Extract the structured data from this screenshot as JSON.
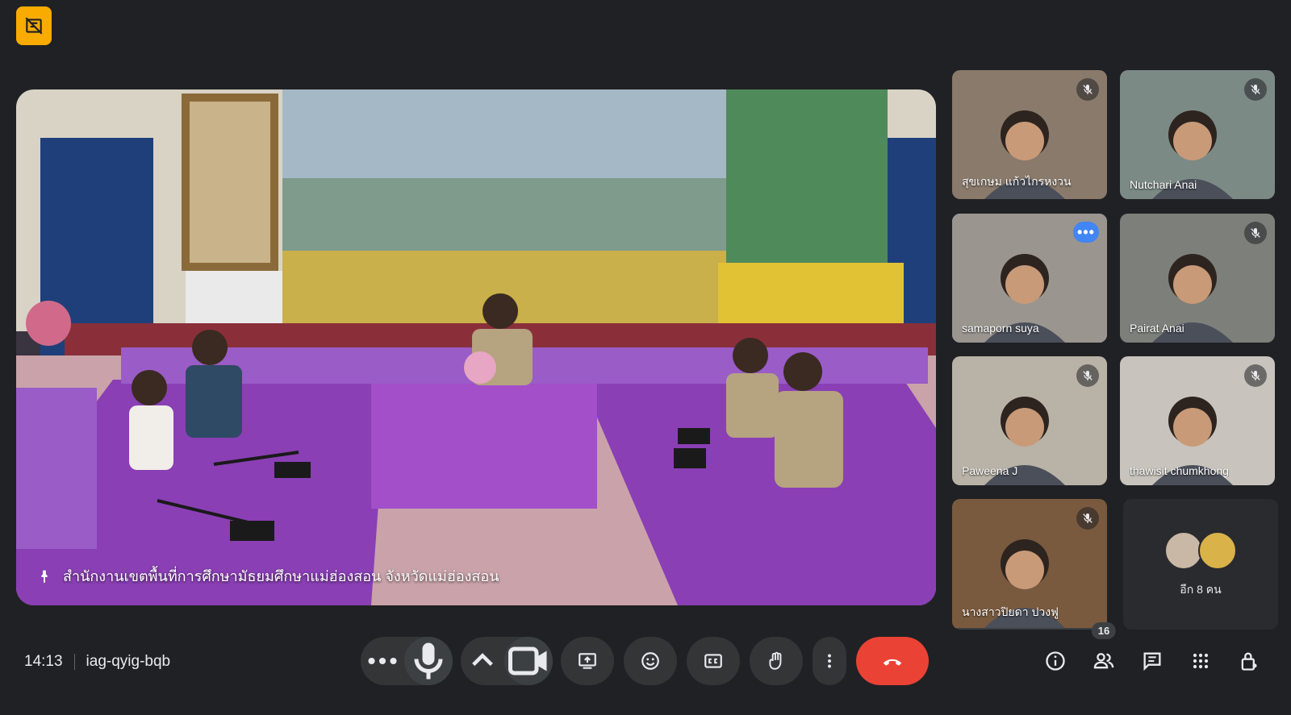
{
  "meeting": {
    "time": "14:13",
    "code": "iag-qyig-bqb"
  },
  "presenter": {
    "caption": "สำนักงานเขตพื้นที่การศึกษามัธยมศึกษาแม่ฮ่องสอน จังหวัดแม่ฮ่องสอน"
  },
  "participants": [
    {
      "name": "สุขเกษม แก้วไกรหงวน",
      "muted": true,
      "bg": "#8a7a6b"
    },
    {
      "name": "Nutchari Anai",
      "muted": true,
      "bg": "#7c8a86"
    },
    {
      "name": "samaporn suya",
      "muted": false,
      "bg": "#9a958f",
      "active": true
    },
    {
      "name": "Pairat Anai",
      "muted": true,
      "bg": "#7d7f7a"
    },
    {
      "name": "Paweena J",
      "muted": true,
      "bg": "#b9b2a7"
    },
    {
      "name": "thawisit chumkhong",
      "muted": true,
      "bg": "#c8c3bc"
    },
    {
      "name": "นางสาวปิยดา ปวงฟู",
      "muted": true,
      "bg": "#7a5a3e"
    }
  ],
  "others": {
    "label": "อีก 8 คน"
  },
  "people_count": "16",
  "icons": {
    "record": "recording-off-icon",
    "more_options": "more-horizontal-icon",
    "mic": "mic-icon",
    "camera_options": "chevron-up-icon",
    "camera": "videocam-icon",
    "present": "present-screen-icon",
    "reactions": "emoji-icon",
    "captions": "closed-captions-icon",
    "raise_hand": "hand-icon",
    "more": "more-vertical-icon",
    "end_call": "call-end-icon",
    "info": "info-icon",
    "people": "people-icon",
    "chat": "chat-icon",
    "activities": "apps-grid-icon",
    "host_controls": "lock-person-icon"
  },
  "colors": {
    "background": "#202124",
    "end_call": "#ea4335",
    "active_outline": "#a8c7fa",
    "record_badge": "#f9ab00"
  }
}
